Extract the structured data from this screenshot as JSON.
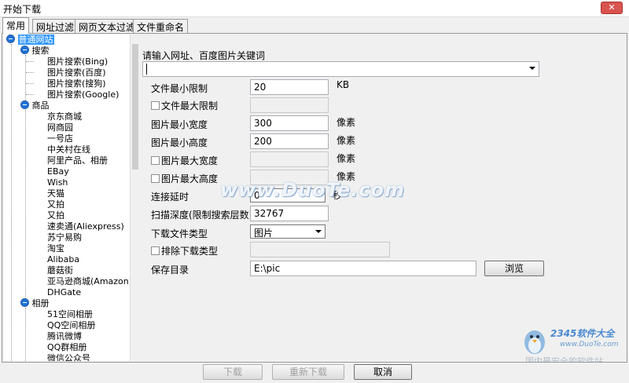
{
  "window": {
    "title": "开始下载",
    "close_label": "✕"
  },
  "tabs": [
    {
      "label": "常用",
      "active": true
    },
    {
      "label": "网址过滤",
      "active": false
    },
    {
      "label": "网页文本过滤",
      "active": false
    },
    {
      "label": "文件重命名",
      "active": false
    }
  ],
  "tree": {
    "root": "普通网站",
    "groups": [
      {
        "label": "搜索",
        "items": [
          "图片搜索(Bing)",
          "图片搜索(百度)",
          "图片搜索(搜狗)",
          "图片搜索(Google)"
        ]
      },
      {
        "label": "商品",
        "items": [
          "京东商城",
          "网商园",
          "一号店",
          "中关村在线",
          "阿里产品、相册",
          "EBay",
          "Wish",
          "天猫",
          "又拍",
          "又拍",
          "速卖通(Aliexpress)",
          "苏宁易购",
          "淘宝",
          "Alibaba",
          "蘑菇街",
          "亚马逊商城(Amazon)",
          "DHGate"
        ]
      },
      {
        "label": "相册",
        "items": [
          "51空间相册",
          "QQ空间相册",
          "腾讯微博",
          "QQ群相册",
          "微信公众号"
        ]
      }
    ]
  },
  "form": {
    "url_label": "请输入网址、百度图片关键词",
    "url_value": "",
    "min_size_label": "文件最小限制",
    "min_size_value": "20",
    "size_unit": "KB",
    "max_size_label": "文件最大限制",
    "max_size_value": "",
    "min_width_label": "图片最小宽度",
    "min_width_value": "300",
    "min_height_label": "图片最小高度",
    "min_height_value": "200",
    "max_width_label": "图片最大宽度",
    "max_width_value": "",
    "max_height_label": "图片最大高度",
    "max_height_value": "",
    "pixel_unit": "像素",
    "delay_label": "连接延时",
    "delay_value": "0",
    "delay_unit": "秒",
    "depth_label": "扫描深度(限制搜索层数)",
    "depth_value": "32767",
    "type_label": "下载文件类型",
    "type_value": "图片",
    "exclude_label": "排除下载类型",
    "exclude_value": "",
    "save_dir_label": "保存目录",
    "save_dir_value": "E:\\pic",
    "browse_label": "浏览"
  },
  "buttons": {
    "download": "下载",
    "redownload": "重新下载",
    "cancel": "取消"
  },
  "watermark": "www.DuoTe.com",
  "logo": {
    "brand": "2345软件大全",
    "url": "www.DuoTe.com",
    "tagline": "国内最安全的软件站"
  }
}
